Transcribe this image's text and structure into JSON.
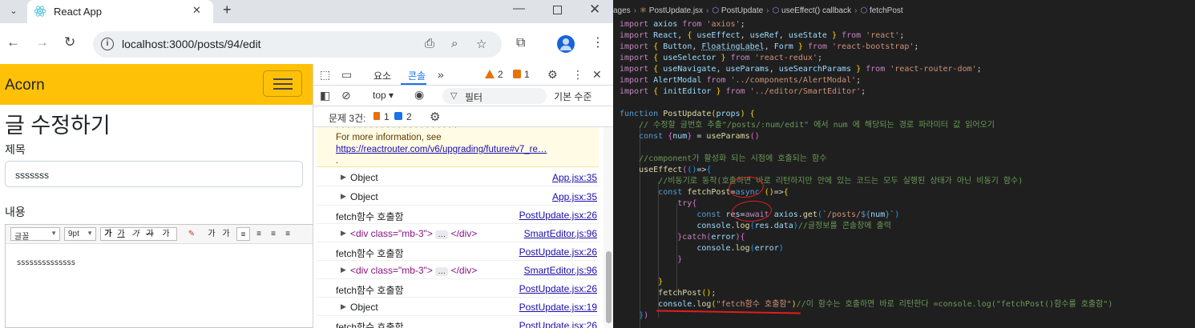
{
  "browser": {
    "tab_title": "React App",
    "url": "localhost:3000/posts/94/edit"
  },
  "page": {
    "brand": "Acorn",
    "heading": "글 수정하기",
    "title_label": "제목",
    "title_value": "sssssss",
    "content_label": "내용",
    "editor": {
      "font_family": "글꼴",
      "font_size": "9pt",
      "buttons": [
        "가",
        "가",
        "가",
        "가",
        "가",
        "가",
        "가",
        "가"
      ],
      "body_text": "ssssssssssssss"
    }
  },
  "devtools": {
    "tabs": [
      "요소",
      "콘솔"
    ],
    "active_tab": "콘솔",
    "error_count": "2",
    "warning_count": "1",
    "context": "top",
    "filter_placeholder": "필터",
    "level": "기본 수준",
    "issues_label": "문제 3건:",
    "issues_errors": "1",
    "issues_info": "2",
    "warning_lines": [
      "For more information, see",
      "https://reactrouter.com/v6/upgrading/future#v7_re…",
      "."
    ],
    "logs": [
      {
        "text": "Object",
        "source": "App.jsx:35",
        "kind": "object"
      },
      {
        "text": "Object",
        "source": "App.jsx:35",
        "kind": "object"
      },
      {
        "text": "fetch함수 호출함",
        "source": "PostUpdate.jsx:26",
        "kind": "text"
      },
      {
        "text": "<div class=\"mb-3\">",
        "source": "SmartEditor.js:96",
        "kind": "element"
      },
      {
        "text": "fetch함수 호출함",
        "source": "PostUpdate.jsx:26",
        "kind": "text"
      },
      {
        "text": "<div class=\"mb-3\">",
        "source": "SmartEditor.js:96",
        "kind": "element"
      },
      {
        "text": "fetch함수 호출함",
        "source": "PostUpdate.jsx:26",
        "kind": "text"
      },
      {
        "text": "Object",
        "source": "PostUpdate.jsx:19",
        "kind": "object"
      },
      {
        "text": "fetch함수 호출함",
        "source": "PostUpdate.jsx:26",
        "kind": "text"
      }
    ]
  },
  "vscode": {
    "breadcrumb": [
      "ages",
      "PostUpdate.jsx",
      "PostUpdate",
      "useEffect() callback",
      "fetchPost"
    ],
    "annotation_color": "#e01e1e"
  }
}
